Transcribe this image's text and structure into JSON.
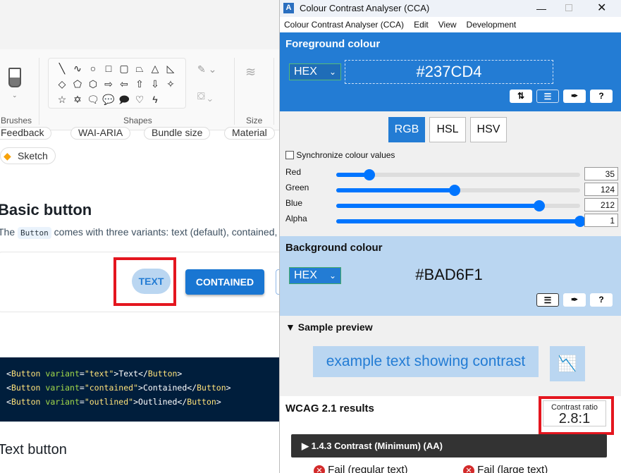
{
  "paint": {
    "groups": {
      "brushes": "Brushes",
      "shapes": "Shapes",
      "size": "Size"
    },
    "shape_glyphs": [
      "╲",
      "∿",
      "○",
      "□",
      "▢",
      "⏢",
      "△",
      "◺",
      "◇",
      "⬠",
      "⬡",
      "⇨",
      "⇦",
      "⇧",
      "⇩",
      "✧",
      "☆",
      "✡",
      "🗨",
      "💬",
      "🗩",
      "♡",
      "ϟ"
    ]
  },
  "page": {
    "chips": [
      "Feedback",
      "WAI-ARIA",
      "Bundle size",
      "Material",
      "Sketch"
    ],
    "heading": "Basic button",
    "desc_before": "The ",
    "desc_code": "Button",
    "desc_after": " comes with three variants: text (default), contained, and outlined.",
    "buttons": {
      "text": "TEXT",
      "contained": "CONTAINED"
    },
    "code": [
      {
        "tag": "Button",
        "attr": "variant",
        "val": "\"text\"",
        "content": "Text"
      },
      {
        "tag": "Button",
        "attr": "variant",
        "val": "\"contained\"",
        "content": "Contained"
      },
      {
        "tag": "Button",
        "attr": "variant",
        "val": "\"outlined\"",
        "content": "Outlined"
      }
    ],
    "subheading": "Text button"
  },
  "cca": {
    "title": "Colour Contrast Analyser (CCA)",
    "menu": [
      "Colour Contrast Analyser (CCA)",
      "Edit",
      "View",
      "Development"
    ],
    "foreground": {
      "title": "Foreground colour",
      "format": "HEX",
      "value": "#237CD4",
      "color": "#237CD4"
    },
    "modes": [
      "RGB",
      "HSL",
      "HSV"
    ],
    "active_mode": "RGB",
    "sync_label": "Synchronize colour values",
    "sync_checked": false,
    "channels": [
      {
        "label": "Red",
        "value": 35,
        "max": 255
      },
      {
        "label": "Green",
        "value": 124,
        "max": 255
      },
      {
        "label": "Blue",
        "value": 212,
        "max": 255
      },
      {
        "label": "Alpha",
        "value": 1,
        "max": 1
      }
    ],
    "background": {
      "title": "Background colour",
      "format": "HEX",
      "value": "#BAD6F1",
      "color": "#BAD6F1"
    },
    "sample": {
      "title": "Sample preview",
      "text": "example text showing contrast"
    },
    "results": {
      "title": "WCAG 2.1 results",
      "ratio_label": "Contrast ratio",
      "ratio": "2.8:1",
      "criterion": "1.4.3 Contrast (Minimum) (AA)",
      "regular": "Fail (regular text)",
      "large": "Fail (large text)"
    }
  }
}
